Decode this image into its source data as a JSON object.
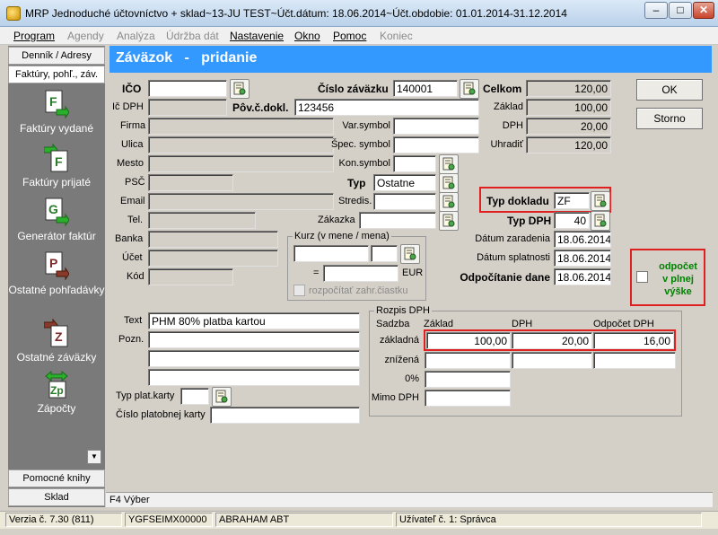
{
  "window": {
    "title": "MRP Jednoduché účtovníctvo + sklad~13-JU TEST~Účt.dátum: 18.06.2014~Účt.obdobie: 01.01.2014-31.12.2014",
    "btn_min": "–",
    "btn_max": "□",
    "btn_close": "✕"
  },
  "menu": [
    {
      "label": "Program",
      "enabled": true
    },
    {
      "label": "Agendy",
      "enabled": false
    },
    {
      "label": "Analýza",
      "enabled": false
    },
    {
      "label": "Údržba dát",
      "enabled": false
    },
    {
      "label": "Nastavenie",
      "enabled": true
    },
    {
      "label": "Okno",
      "enabled": true
    },
    {
      "label": "Pomoc",
      "enabled": true
    },
    {
      "label": "Koniec",
      "enabled": false
    }
  ],
  "sidebar": {
    "top_tabs": [
      "Denník / Adresy",
      "Faktúry, pohľ., záv."
    ],
    "items": [
      {
        "label": "Faktúry vydané",
        "icon": "F"
      },
      {
        "label": "Faktúry prijaté",
        "icon": "F"
      },
      {
        "label": "Generátor faktúr",
        "icon": "G"
      },
      {
        "label": "Ostatné pohľadávky",
        "icon": "P"
      },
      {
        "label": "Ostatné záväzky",
        "icon": "Z"
      },
      {
        "label": "Zápočty",
        "icon": "Zp"
      }
    ],
    "bottom_tabs": [
      "Pomocné knihy",
      "Sklad"
    ]
  },
  "form": {
    "heading": "Záväzok   -   pridanie",
    "left_labels": {
      "ico": "IČO",
      "ic_dph": "Ič DPH",
      "firma": "Firma",
      "ulica": "Ulica",
      "mesto": "Mesto",
      "psc": "PSČ",
      "email": "Email",
      "tel": "Tel.",
      "banka": "Banka",
      "ucet": "Účet",
      "kod": "Kód"
    },
    "cislo_zavazku": {
      "label": "Číslo záväzku",
      "value": "140001"
    },
    "pov_c_dokl": {
      "label": "Pôv.č.dokl.",
      "value": "123456"
    },
    "var_symbol": {
      "label": "Var.symbol",
      "value": ""
    },
    "spec_symbol": {
      "label": "Špec. symbol",
      "value": ""
    },
    "kon_symbol": {
      "label": "Kon.symbol",
      "value": ""
    },
    "typ": {
      "label": "Typ",
      "value": "Ostatne"
    },
    "stredis": {
      "label": "Stredis.",
      "value": ""
    },
    "zakazka": {
      "label": "Zákazka",
      "value": ""
    },
    "kurz": {
      "label": "Kurz (v mene / mena)",
      "eq": "=",
      "currency": "EUR",
      "checkbox_label": "rozpočítať zahr.čiastku"
    },
    "totals": {
      "celkom": {
        "label": "Celkom",
        "value": "120,00"
      },
      "zaklad": {
        "label": "Základ",
        "value": "100,00"
      },
      "dph": {
        "label": "DPH",
        "value": "20,00"
      },
      "uhradit": {
        "label": "Uhradiť",
        "value": "120,00"
      }
    },
    "typ_dokladu": {
      "label": "Typ dokladu",
      "value": "ZF"
    },
    "typ_dph": {
      "label": "Typ DPH",
      "value": "40"
    },
    "datum_zaradenia": {
      "label": "Dátum zaradenia",
      "value": "18.06.2014"
    },
    "datum_splatnosti": {
      "label": "Dátum splatnosti",
      "value": "18.06.2014"
    },
    "odpocitanie_dane": {
      "label": "Odpočítanie dane",
      "value": "18.06.2014"
    },
    "odpocet": {
      "label": "odpočet v plnej výške",
      "line1": "odpočet",
      "line2": "v plnej",
      "line3": "výške"
    },
    "text": {
      "label": "Text",
      "value": "PHM 80% platba kartou"
    },
    "pozn": {
      "label": "Pozn."
    },
    "typ_plat_karty": {
      "label": "Typ plat.karty",
      "value": ""
    },
    "cislo_platobnej_karty": {
      "label": "Číslo platobnej karty",
      "value": ""
    },
    "rozpis": {
      "title": "Rozpis DPH",
      "headers": {
        "sadzba": "Sadzba",
        "zaklad": "Základ",
        "dph": "DPH",
        "odpocet": "Odpočet DPH"
      },
      "rows": [
        {
          "label": "základná",
          "zaklad": "100,00",
          "dph": "20,00",
          "odpocet": "16,00"
        },
        {
          "label": "znížená",
          "zaklad": "",
          "dph": "",
          "odpocet": ""
        },
        {
          "label": "0%",
          "zaklad": ""
        },
        {
          "label": "Mimo DPH",
          "zaklad": ""
        }
      ]
    },
    "ok_button": "OK",
    "storno_button": "Storno"
  },
  "hint": "F4 Výber",
  "statusbar": [
    "Verzia č. 7.30 (811)",
    "YGFSEIMX00000",
    "ABRAHAM ABT",
    "Užívateľ č. 1: Správca"
  ],
  "colors": {
    "accent": "#3399ff",
    "highlight": "#e02020",
    "odpocet_text": "#008000"
  }
}
